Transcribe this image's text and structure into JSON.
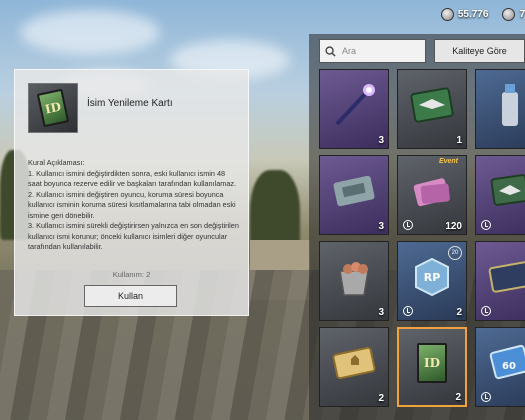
{
  "top_bar": {
    "currency_1": "55.776",
    "currency_2": "7"
  },
  "info_panel": {
    "item_title": "İsim Yenileme Kartı",
    "item_icon_text": "ID",
    "rules_heading": "Kural Açıklaması:",
    "rules": [
      "1. Kullanıcı ismini değiştirdikten sonra, eski kullanıcı ismin 48 saat boyunca rezerve edilir ve başkaları tarafından kullanılamaz.",
      "2. Kullanıcı ismini değiştiren oyuncu, koruma süresi boyunca kullanıcı isminin koruma süresi kısıtlamalarına tabi olmadan eski ismine geri dönebilir.",
      "3. Kullanıcı ismini sürekli değiştirirsen yalnızca en son değiştirilen kullanıcı ismi korunur; önceki kullanıcı isimleri diğer oyuncular tarafından kullanılabilir."
    ],
    "usage_count": "Kullanım: 2",
    "use_button": "Kullan"
  },
  "inventory": {
    "search_placeholder": "Ara",
    "sort_button": "Kaliteye Göre",
    "slots": [
      {
        "name": "magic-wand-item",
        "quantity": "3",
        "timer": false
      },
      {
        "name": "wings-card-item",
        "quantity": "1",
        "timer": false
      },
      {
        "name": "spray-can-item",
        "quantity": "",
        "timer": false
      },
      {
        "name": "ticket-item",
        "quantity": "3",
        "timer": false
      },
      {
        "name": "event-coupon-item",
        "quantity": "120",
        "timer": true,
        "tag": "Event"
      },
      {
        "name": "purple-card-item",
        "quantity": "",
        "timer": true
      },
      {
        "name": "bucket-item",
        "quantity": "3",
        "timer": false
      },
      {
        "name": "rp-card-item",
        "quantity": "2",
        "timer": true,
        "badge": "20"
      },
      {
        "name": "rp-ticket-item",
        "quantity": "",
        "timer": true
      },
      {
        "name": "gold-ticket-item",
        "quantity": "2",
        "timer": false
      },
      {
        "name": "rename-card-item",
        "quantity": "2",
        "timer": false,
        "selected": true
      },
      {
        "name": "blue-card-item",
        "quantity": "",
        "timer": true,
        "label": "60"
      }
    ]
  }
}
